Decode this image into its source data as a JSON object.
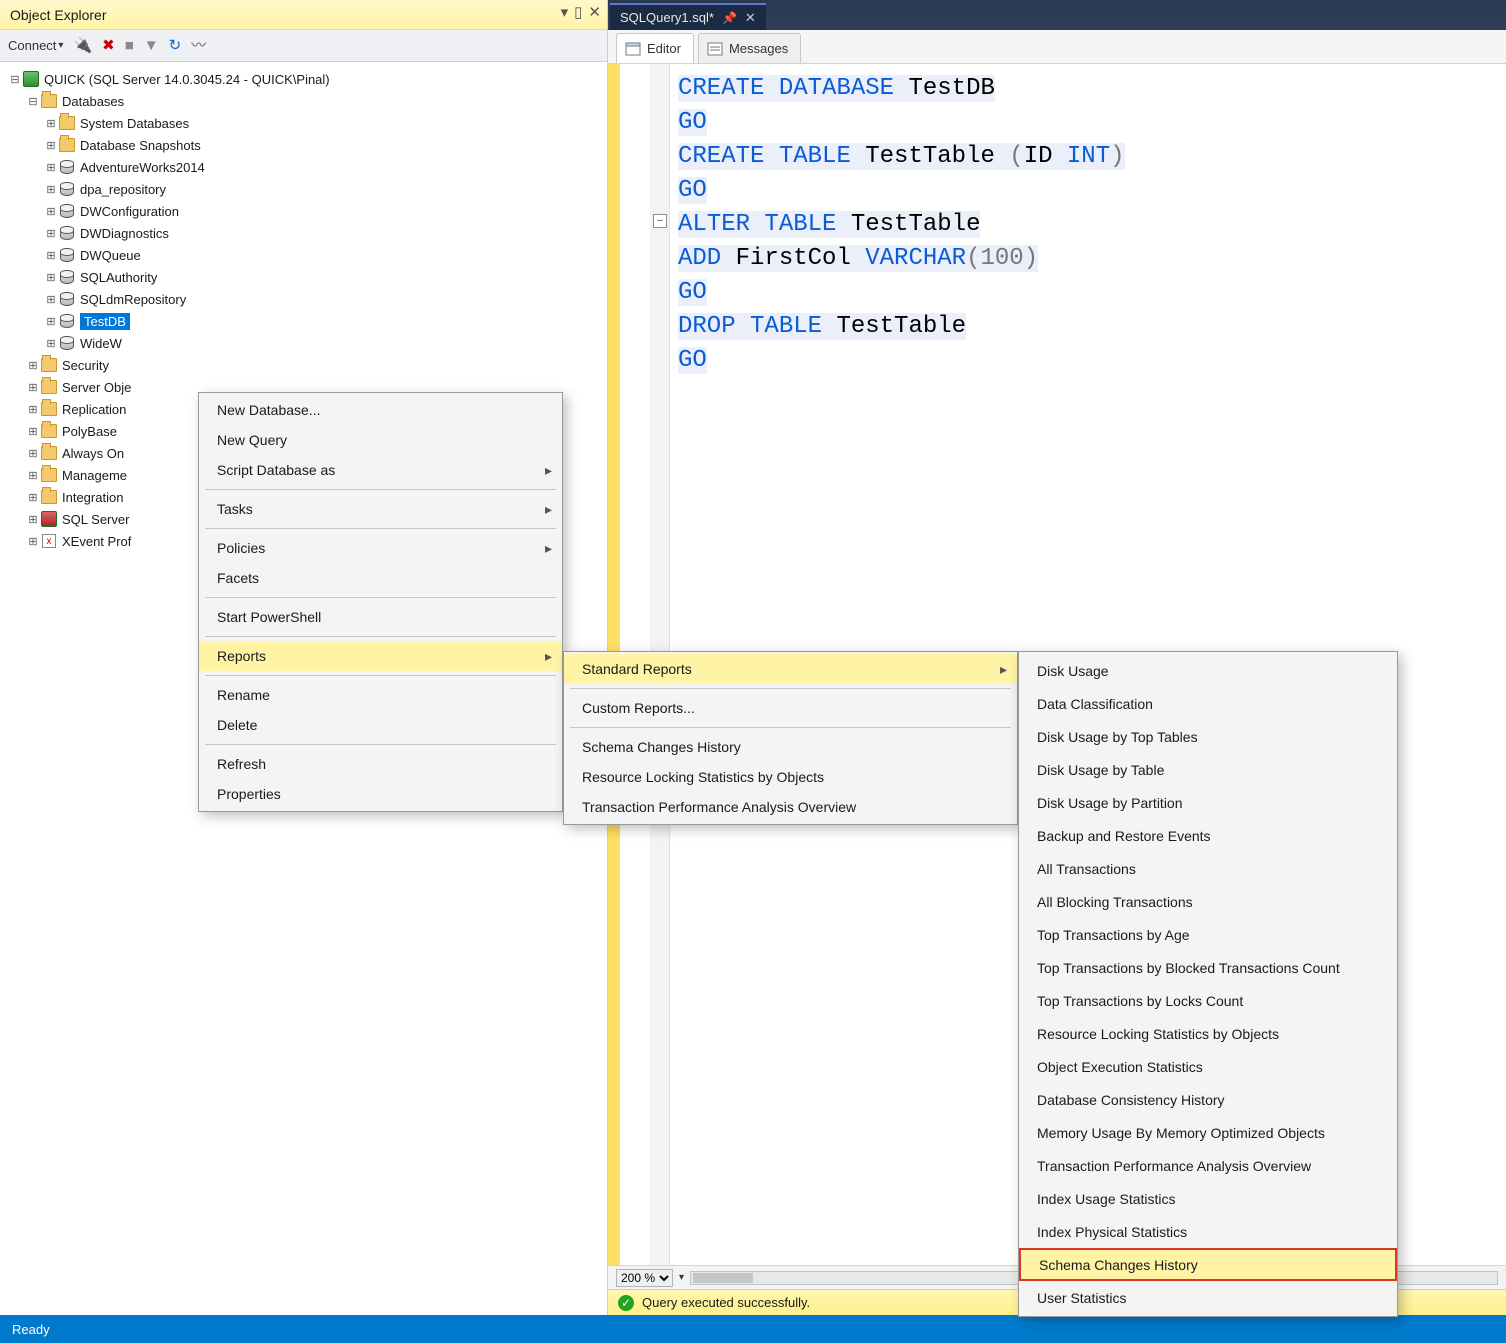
{
  "objectExplorer": {
    "title": "Object Explorer",
    "connectLabel": "Connect",
    "server": "QUICK (SQL Server 14.0.3045.24 - QUICK\\Pinal)",
    "databasesLabel": "Databases",
    "sysDatabases": "System Databases",
    "snapshots": "Database Snapshots",
    "dbs": [
      "AdventureWorks2014",
      "dpa_repository",
      "DWConfiguration",
      "DWDiagnostics",
      "DWQueue",
      "SQLAuthority",
      "SQLdmRepository",
      "TestDB",
      "WideWorldImporters"
    ],
    "serverNodes": [
      "Security",
      "Server Objects",
      "Replication",
      "PolyBase",
      "Always On High Availability",
      "Management",
      "Integration Services Catalogs",
      "SQL Server Agent",
      "XEvent Profiler"
    ]
  },
  "docTab": {
    "title": "SQLQuery1.sql*"
  },
  "innerTabs": {
    "editor": "Editor",
    "messages": "Messages"
  },
  "code": [
    {
      "tokens": [
        {
          "t": "CREATE",
          "c": "kw"
        },
        {
          "t": " "
        },
        {
          "t": "DATABASE",
          "c": "kw"
        },
        {
          "t": " "
        },
        {
          "t": "TestDB",
          "c": "obj"
        }
      ],
      "hl": true
    },
    {
      "tokens": [
        {
          "t": "GO",
          "c": "kw"
        }
      ],
      "hl": true
    },
    {
      "tokens": [
        {
          "t": "CREATE",
          "c": "kw"
        },
        {
          "t": " "
        },
        {
          "t": "TABLE",
          "c": "kw"
        },
        {
          "t": " "
        },
        {
          "t": "TestTable",
          "c": "obj"
        },
        {
          "t": " ",
          "c": "obj"
        },
        {
          "t": "(",
          "c": "num"
        },
        {
          "t": "ID",
          "c": "obj"
        },
        {
          "t": " "
        },
        {
          "t": "INT",
          "c": "ty"
        },
        {
          "t": ")",
          "c": "num"
        }
      ],
      "hl": true
    },
    {
      "tokens": [
        {
          "t": "GO",
          "c": "kw"
        }
      ],
      "hl": true
    },
    {
      "tokens": [
        {
          "t": "ALTER",
          "c": "kw"
        },
        {
          "t": " "
        },
        {
          "t": "TABLE",
          "c": "kw"
        },
        {
          "t": " "
        },
        {
          "t": "TestTable",
          "c": "obj"
        }
      ],
      "hl": true
    },
    {
      "tokens": [
        {
          "t": "ADD",
          "c": "kw"
        },
        {
          "t": " "
        },
        {
          "t": "FirstCol",
          "c": "obj"
        },
        {
          "t": " "
        },
        {
          "t": "VARCHAR",
          "c": "ty"
        },
        {
          "t": "(",
          "c": "num"
        },
        {
          "t": "100",
          "c": "num"
        },
        {
          "t": ")",
          "c": "num"
        }
      ],
      "hl": true
    },
    {
      "tokens": [
        {
          "t": "GO",
          "c": "kw"
        }
      ],
      "hl": true
    },
    {
      "tokens": [
        {
          "t": "DROP",
          "c": "kw"
        },
        {
          "t": " "
        },
        {
          "t": "TABLE",
          "c": "kw"
        },
        {
          "t": " "
        },
        {
          "t": "TestTable",
          "c": "obj"
        }
      ],
      "hl": true
    },
    {
      "tokens": [
        {
          "t": "GO",
          "c": "kw"
        }
      ],
      "hl": true
    }
  ],
  "zoom": "200 %",
  "statusMsg": "Query executed successfully.",
  "vsStatus": "Ready",
  "ctxMenu1": {
    "items": [
      {
        "label": "New Database..."
      },
      {
        "label": "New Query"
      },
      {
        "label": "Script Database as",
        "arrow": true
      },
      {
        "sep": true
      },
      {
        "label": "Tasks",
        "arrow": true
      },
      {
        "sep": true
      },
      {
        "label": "Policies",
        "arrow": true
      },
      {
        "label": "Facets"
      },
      {
        "sep": true
      },
      {
        "label": "Start PowerShell"
      },
      {
        "sep": true
      },
      {
        "label": "Reports",
        "arrow": true,
        "hi": true
      },
      {
        "sep": true
      },
      {
        "label": "Rename"
      },
      {
        "label": "Delete"
      },
      {
        "sep": true
      },
      {
        "label": "Refresh"
      },
      {
        "label": "Properties"
      }
    ]
  },
  "ctxMenu2": {
    "items": [
      {
        "label": "Standard Reports",
        "arrow": true,
        "hi": true
      },
      {
        "sep": true
      },
      {
        "label": "Custom Reports..."
      },
      {
        "sep": true
      },
      {
        "label": "Schema Changes History"
      },
      {
        "label": "Resource Locking Statistics by Objects"
      },
      {
        "label": "Transaction Performance Analysis Overview"
      }
    ]
  },
  "ctxMenu3": {
    "items": [
      "Disk Usage",
      "Data Classification",
      "Disk Usage by Top Tables",
      "Disk Usage by Table",
      "Disk Usage by Partition",
      "Backup and Restore Events",
      "All Transactions",
      "All Blocking Transactions",
      "Top Transactions by Age",
      "Top Transactions by Blocked Transactions Count",
      "Top Transactions by Locks Count",
      "Resource Locking Statistics by Objects",
      "Object Execution Statistics",
      "Database Consistency History",
      "Memory Usage By Memory Optimized Objects",
      "Transaction Performance Analysis Overview",
      "Index Usage Statistics",
      "Index Physical Statistics",
      "Schema Changes History",
      "User Statistics"
    ],
    "highlightedIndex": 18
  }
}
